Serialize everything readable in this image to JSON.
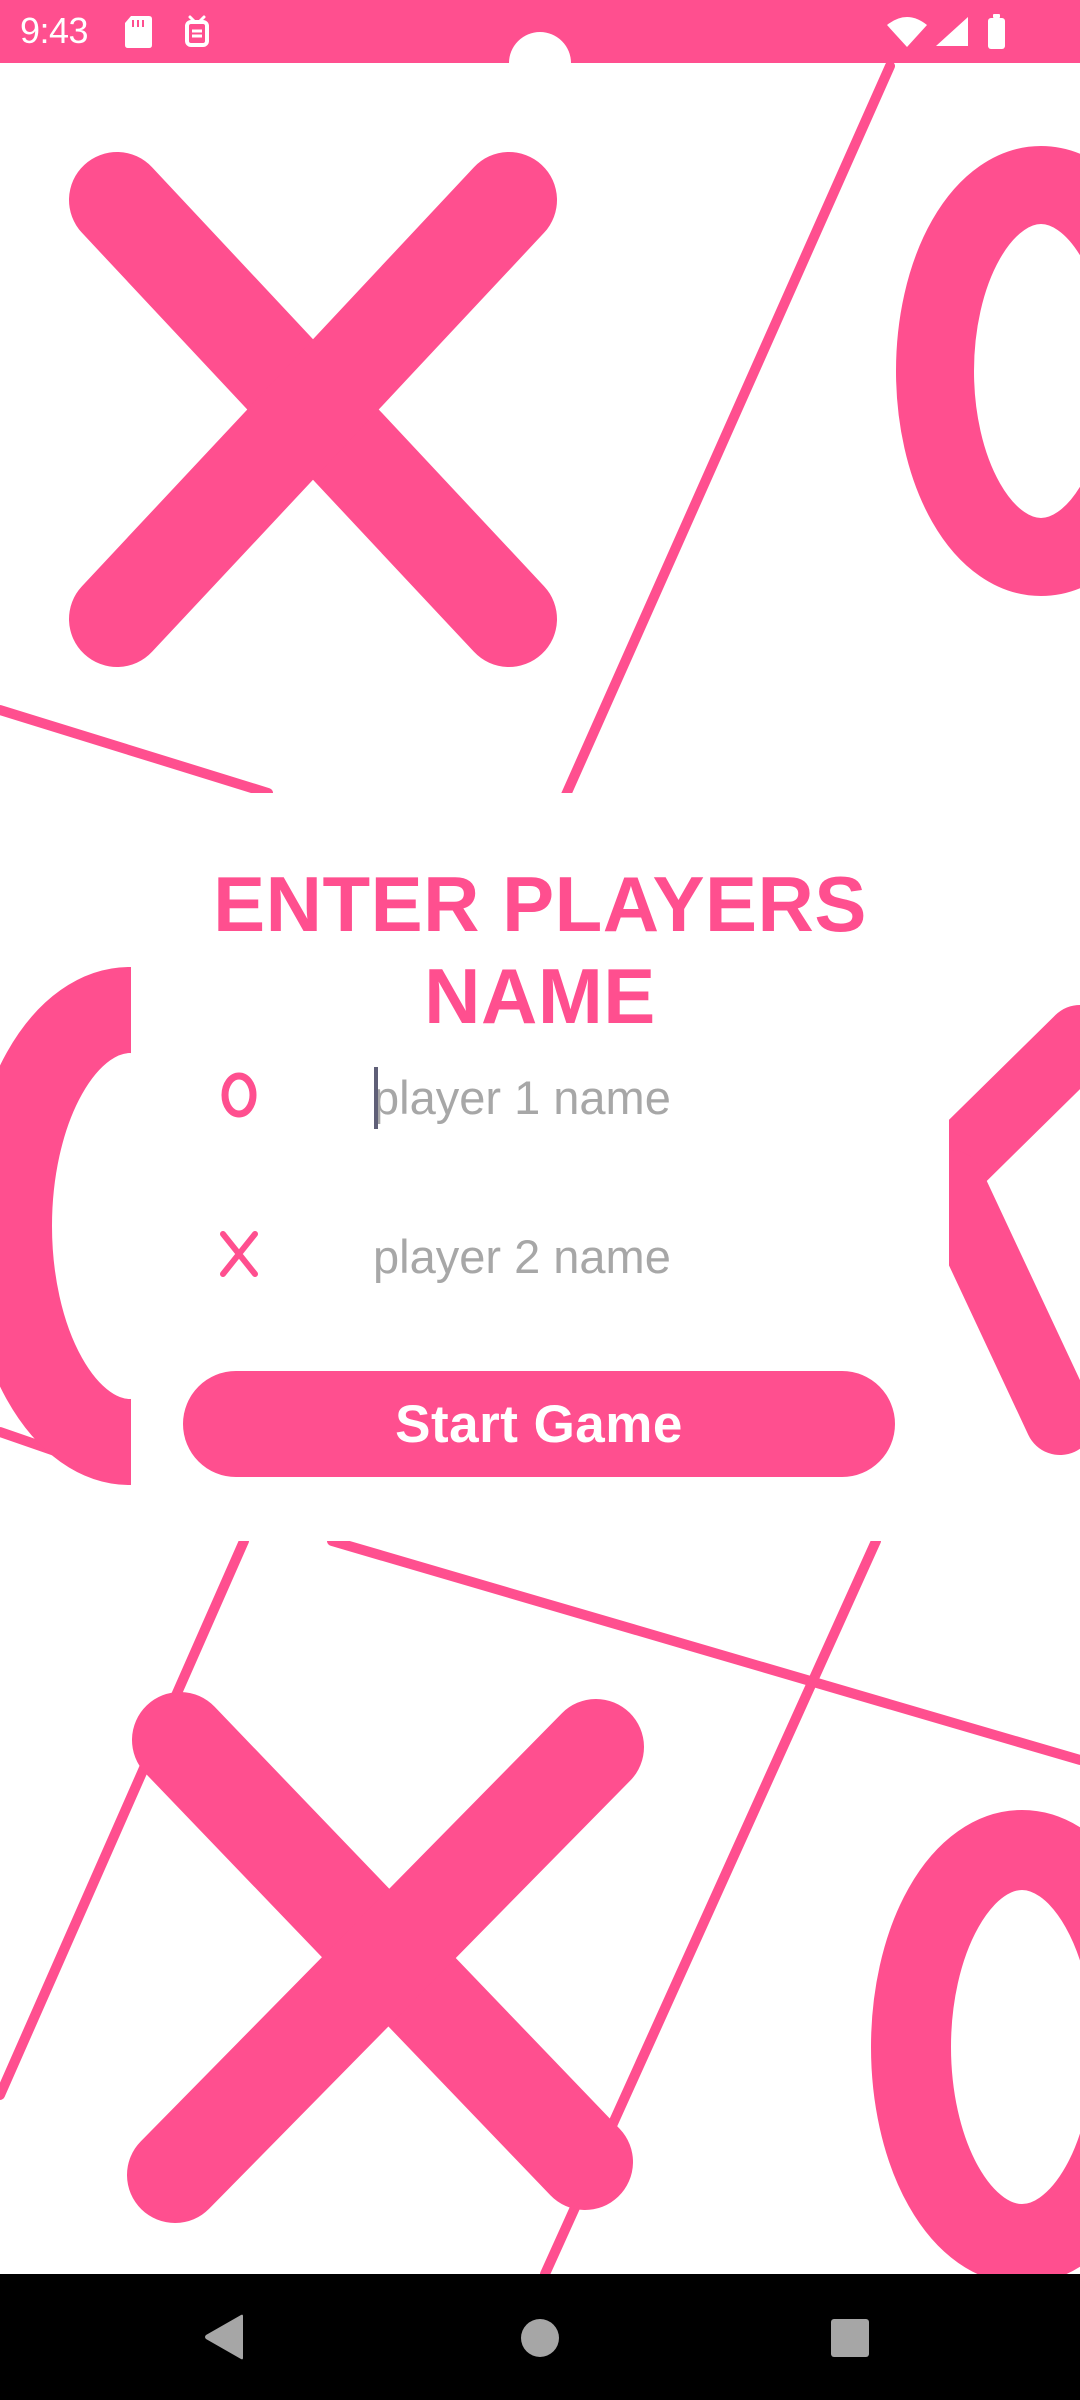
{
  "status_bar": {
    "time": "9:43",
    "left_icons": [
      "sd-card-icon",
      "tray-app-icon"
    ],
    "right_icons": [
      "wifi-icon",
      "signal-icon",
      "battery-icon"
    ]
  },
  "background": {
    "marks": [
      "x-mark",
      "o-mark",
      "x-mark",
      "o-mark",
      "x-mark",
      "o-mark"
    ],
    "accent_color": "#ff4f8f"
  },
  "form": {
    "title": "ENTER PLAYERS NAME",
    "player_1": {
      "icon": "o-marker-icon",
      "value": "",
      "placeholder": "player 1 name",
      "focused": true
    },
    "player_2": {
      "icon": "x-marker-icon",
      "value": "",
      "placeholder": "player 2 name",
      "focused": false
    },
    "start_button": "Start Game"
  },
  "nav_bar": {
    "buttons": [
      "back-icon",
      "home-icon",
      "recent-apps-icon"
    ]
  }
}
